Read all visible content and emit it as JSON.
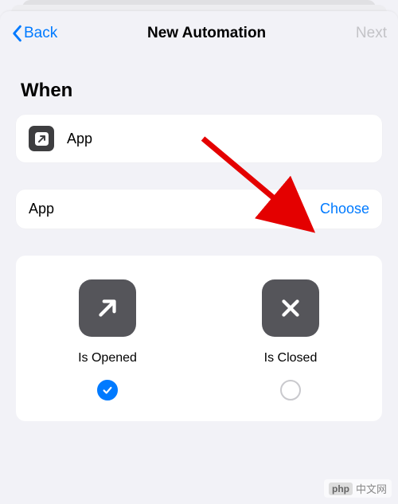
{
  "nav": {
    "back_label": "Back",
    "title": "New Automation",
    "next_label": "Next"
  },
  "section": {
    "title": "When"
  },
  "trigger": {
    "icon": "arrow-up-right",
    "label": "App"
  },
  "chooser": {
    "label": "App",
    "action": "Choose"
  },
  "options": {
    "opened": {
      "label": "Is Opened",
      "selected": true
    },
    "closed": {
      "label": "Is Closed",
      "selected": false
    }
  },
  "watermark": {
    "logo": "php",
    "text": "中文网"
  }
}
